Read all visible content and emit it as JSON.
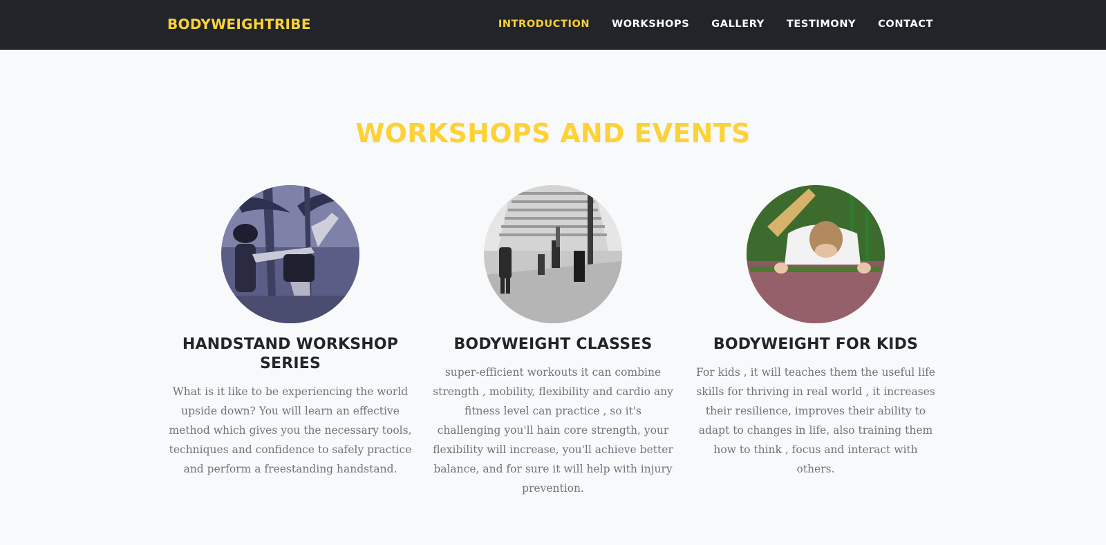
{
  "brand": "BODYWEIGHTRIBE",
  "nav": {
    "introduction": "INTRODUCTION",
    "workshops": "WORKSHOPS",
    "gallery": "GALLERY",
    "testimony": "TESTIMONY",
    "contact": "CONTACT"
  },
  "colors": {
    "accent": "#fed136",
    "navbar_bg": "#212529",
    "page_bg": "#f8f9fa",
    "heading": "#212529",
    "muted_text": "#6c757d"
  },
  "section": {
    "title": "WORKSHOPS AND EVENTS"
  },
  "workshops": [
    {
      "title": "HANDSTAND WORKSHOP SERIES",
      "description": "What is it like to be experiencing the world upside down? You will learn an effective method which gives you the necessary tools, techniques and confidence to safely practice and perform a freestanding handstand."
    },
    {
      "title": "BODYWEIGHT CLASSES",
      "description": "super-efficient workouts it can combine strength , mobility, flexibility and cardio any fitness level can practice , so it's challenging you'll hain core strength, your flexibility will increase, you'll achieve better balance, and for sure it will help with injury prevention."
    },
    {
      "title": "BODYWEIGHT FOR KIDS",
      "description": "For kids , it will teaches them the useful life skills for thriving in real world , it increases their resilience, improves their ability to adapt to changes in life, also training them how to think , focus and interact with others."
    }
  ]
}
